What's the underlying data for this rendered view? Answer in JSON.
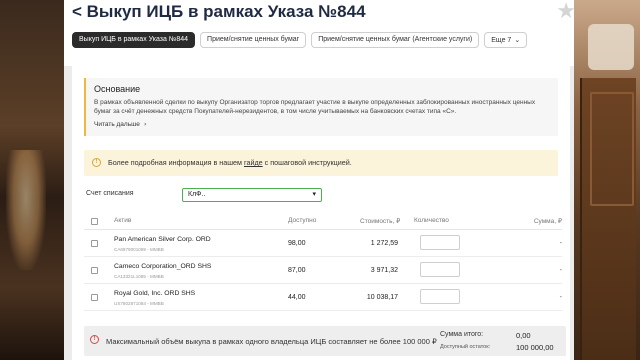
{
  "header": {
    "title": "< Выкуп ИЦБ в рамках Указа №844",
    "star_icon": "star-icon"
  },
  "tabs": [
    {
      "label": "Выкуп ИЦБ в рамках Указа №844",
      "active": true
    },
    {
      "label": "Прием/снятие ценных бумаг",
      "active": false
    },
    {
      "label": "Прием/снятие ценных бумаг (Агентские услуги)",
      "active": false
    },
    {
      "label": "Еще 7",
      "active": false
    }
  ],
  "basis": {
    "title": "Основание",
    "text": "В рамках объявленной сделки по выкупу Организатор торгов предлагает участие в выкупе определенных заблокированных иностранных ценных бумаг за счёт денежных средств Покупателей-нерезидентов, в том числе учитываемых на банковских счетах типа «С».",
    "more": "Читать дальше",
    "accent_color": "#f0b840"
  },
  "info": {
    "text_before": "Более подробная информация в нашем ",
    "link": "гайде",
    "text_after": " с пошаговой инструкцией."
  },
  "account": {
    "label": "Счет списания",
    "value": "КлФ.."
  },
  "table": {
    "headers": {
      "asset": "Актив",
      "available": "Доступно",
      "cost": "Стоимость, ₽",
      "quantity": "Количество",
      "sum": "Сумма, ₽"
    },
    "rows": [
      {
        "name": "Pan American Silver Corp. ORD",
        "isin": "CA6979001089 - MMBB",
        "available": "98,00",
        "cost": "1 272,59",
        "sum": "-"
      },
      {
        "name": "Cameco Corporation_ORD SHS",
        "isin": "CA13321L1085 - MMBB",
        "available": "87,00",
        "cost": "3 971,32",
        "sum": "-"
      },
      {
        "name": "Royal Gold, Inc. ORD SHS",
        "isin": "US7802871084 - MMBB",
        "available": "44,00",
        "cost": "10 038,17",
        "sum": "-"
      }
    ]
  },
  "footer": {
    "warning": "Максимальный объём выкупа в рамках одного владельца ИЦБ составляет не более 100 000 ₽",
    "total_label": "Сумма итого:",
    "total_value": "0,00",
    "available_label": "Доступный остаток:",
    "available_value": "100 000,00"
  },
  "colors": {
    "active_tab": "#2b2b2b",
    "select_border": "#4caf50",
    "info_bg": "#fbf3da",
    "warning": "#dd4444"
  }
}
